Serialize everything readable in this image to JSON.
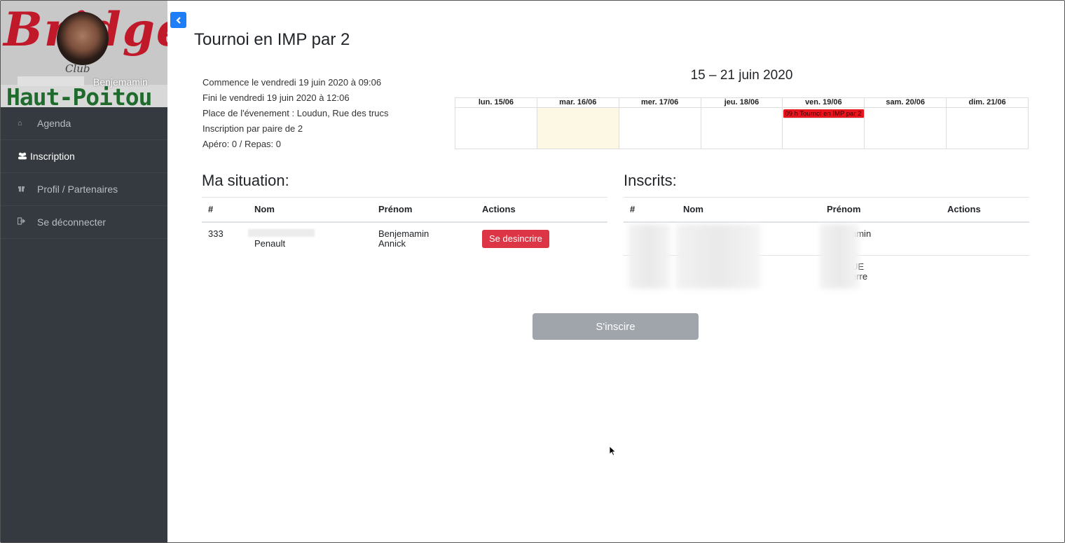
{
  "sidebar": {
    "logo_script": "Bridge",
    "logo_club": "Club",
    "logo_bottom": "Haut-Poitou",
    "user_name": "Benjemamin",
    "items": [
      {
        "label": "Agenda",
        "icon": "home-icon"
      },
      {
        "label": "Inscription",
        "icon": "users-icon",
        "active": true
      },
      {
        "label": "Profil / Partenaires",
        "icon": "gift-icon"
      },
      {
        "label": "Se déconnecter",
        "icon": "sign-out-icon"
      }
    ]
  },
  "page": {
    "title": "Tournoi en IMP par 2",
    "info": [
      "Commence le vendredi 19 juin 2020 à 09:06",
      "Fini le vendredi 19 juin 2020 à 12:06",
      "Place de l'évenement : Loudun, Rue des trucs",
      "Inscription par paire de 2",
      "Apéro: 0 / Repas: 0"
    ]
  },
  "calendar": {
    "title": "15 – 21 juin 2020",
    "days": [
      "lun. 15/06",
      "mar. 16/06",
      "mer. 17/06",
      "jeu. 18/06",
      "ven. 19/06",
      "sam. 20/06",
      "dim. 21/06"
    ],
    "event": "09 h Tournoi en IMP par 2",
    "colors": {
      "event": "#e8141e",
      "today": "#fcf8e3"
    }
  },
  "ma_situation": {
    "title": "Ma situation:",
    "headers": [
      "#",
      "Nom",
      "Prénom",
      "Actions"
    ],
    "row": {
      "num": "333",
      "nom2": "Penault",
      "prenom1": "Benjemamin",
      "prenom2": "Annick",
      "action": "Se desincrire"
    }
  },
  "inscrits": {
    "title": "Inscrits:",
    "headers": [
      "#",
      "Nom",
      "Prénom",
      "Actions"
    ],
    "rows": [
      {
        "prenom_visible": "amin"
      },
      {
        "prenom_visible_1": "UE",
        "prenom_visible_2": "erre"
      }
    ]
  },
  "actions": {
    "inscrire": "S'inscire"
  },
  "colors": {
    "sidebar": "#343a40",
    "primary": "#1e7ef7",
    "danger": "#dc3545",
    "disabled": "#a0a5ab"
  }
}
